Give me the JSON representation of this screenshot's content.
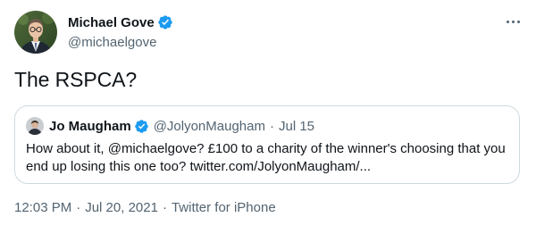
{
  "tweet": {
    "author": {
      "display_name": "Michael Gove",
      "handle": "@michaelgove",
      "verified": true,
      "avatar_icon": "profile-photo"
    },
    "more_icon": "more-horizontal-icon",
    "text": "The RSPCA?",
    "quoted": {
      "display_name": "Jo Maugham",
      "handle": "@JolyonMaugham",
      "separator": "·",
      "date": "Jul 15",
      "verified": true,
      "text": "How about it, @michaelgove? £100 to a charity of the winner's choosing that you end up losing this one too? twitter.com/JolyonMaugham/..."
    },
    "meta": {
      "time": "12:03 PM",
      "separator": "·",
      "date": "Jul 20, 2021",
      "source": "Twitter for iPhone"
    }
  },
  "colors": {
    "verified_blue": "#1d9bf0",
    "secondary_text": "#536471",
    "primary_text": "#0f1419",
    "border": "#cfd9de"
  }
}
